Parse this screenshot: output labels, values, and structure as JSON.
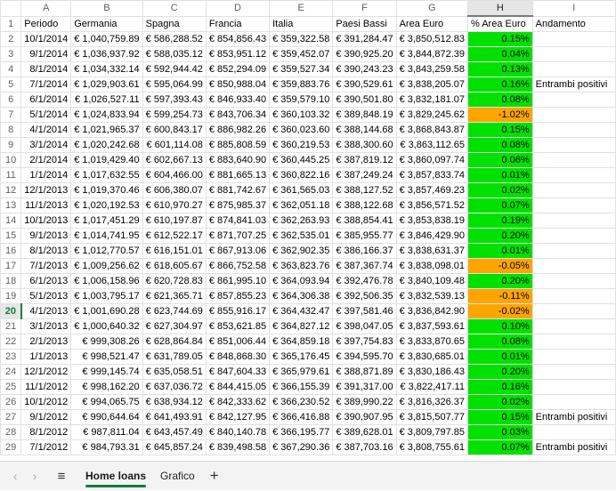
{
  "columns": [
    "A",
    "B",
    "C",
    "D",
    "E",
    "F",
    "G",
    "H",
    "I"
  ],
  "active_column": "H",
  "selected_row": "20",
  "header_row": {
    "row": "1",
    "cells": [
      "Periodo",
      "Germania",
      "Spagna",
      "Francia",
      "Italia",
      "Paesi Bassi",
      "Area Euro",
      "% Area Euro",
      "Andamento"
    ]
  },
  "rows": [
    {
      "row": "2",
      "c": [
        "10/1/2014",
        "€ 1,040,759.89",
        "€ 586,288.52",
        "€ 854,856.43",
        "€ 359,322.58",
        "€ 391,284.47",
        "€ 3,850,512.83",
        "0.15%",
        ""
      ],
      "status": "green"
    },
    {
      "row": "3",
      "c": [
        "9/1/2014",
        "€ 1,036,937.92",
        "€ 588,035.12",
        "€ 853,951.12",
        "€ 359,452.07",
        "€ 390,925.20",
        "€ 3,844,872.39",
        "0.04%",
        ""
      ],
      "status": "green"
    },
    {
      "row": "4",
      "c": [
        "8/1/2014",
        "€ 1,034,332.14",
        "€ 592,944.42",
        "€ 852,294.09",
        "€ 359,527.34",
        "€ 390,243.23",
        "€ 3,843,259.58",
        "0.13%",
        ""
      ],
      "status": "green"
    },
    {
      "row": "5",
      "c": [
        "7/1/2014",
        "€ 1,029,903.61",
        "€ 595,064.99",
        "€ 850,988.04",
        "€ 359,883.76",
        "€ 390,529.61",
        "€ 3,838,205.07",
        "0.16%",
        "Entrambi positivi"
      ],
      "status": "green"
    },
    {
      "row": "6",
      "c": [
        "6/1/2014",
        "€ 1,026,527.11",
        "€ 597,393.43",
        "€ 846,933.40",
        "€ 359,579.10",
        "€ 390,501.80",
        "€ 3,832,181.07",
        "0.08%",
        ""
      ],
      "status": "green"
    },
    {
      "row": "7",
      "c": [
        "5/1/2014",
        "€ 1,024,833.94",
        "€ 599,254.73",
        "€ 843,706.34",
        "€ 360,103.32",
        "€ 389,848.19",
        "€ 3,829,245.62",
        "-1.02%",
        ""
      ],
      "status": "orange"
    },
    {
      "row": "8",
      "c": [
        "4/1/2014",
        "€ 1,021,965.37",
        "€ 600,843.17",
        "€ 886,982.26",
        "€ 360,023.60",
        "€ 388,144.68",
        "€ 3,868,843.87",
        "0.15%",
        ""
      ],
      "status": "green"
    },
    {
      "row": "9",
      "c": [
        "3/1/2014",
        "€ 1,020,242.68",
        "€ 601,114.08",
        "€ 885,808.59",
        "€ 360,219.53",
        "€ 388,300.60",
        "€ 3,863,112.65",
        "0.08%",
        ""
      ],
      "status": "green"
    },
    {
      "row": "10",
      "c": [
        "2/1/2014",
        "€ 1,019,429.40",
        "€ 602,667.13",
        "€ 883,640.90",
        "€ 360,445.25",
        "€ 387,819.12",
        "€ 3,860,097.74",
        "0.06%",
        ""
      ],
      "status": "green"
    },
    {
      "row": "11",
      "c": [
        "1/1/2014",
        "€ 1,017,632.55",
        "€ 604,466.00",
        "€ 881,665.13",
        "€ 360,822.16",
        "€ 387,249.24",
        "€ 3,857,833.74",
        "0.01%",
        ""
      ],
      "status": "green"
    },
    {
      "row": "12",
      "c": [
        "12/1/2013",
        "€ 1,019,370.46",
        "€ 606,380.07",
        "€ 881,742.67",
        "€ 361,565.03",
        "€ 388,127.52",
        "€ 3,857,469.23",
        "0.02%",
        ""
      ],
      "status": "green"
    },
    {
      "row": "13",
      "c": [
        "11/1/2013",
        "€ 1,020,192.53",
        "€ 610,970.27",
        "€ 875,985.37",
        "€ 362,051.18",
        "€ 388,122.68",
        "€ 3,856,571.52",
        "0.07%",
        ""
      ],
      "status": "green"
    },
    {
      "row": "14",
      "c": [
        "10/1/2013",
        "€ 1,017,451.29",
        "€ 610,197.87",
        "€ 874,841.03",
        "€ 362,263.93",
        "€ 388,854.41",
        "€ 3,853,838.19",
        "0.19%",
        ""
      ],
      "status": "green"
    },
    {
      "row": "15",
      "c": [
        "9/1/2013",
        "€ 1,014,741.95",
        "€ 612,522.17",
        "€ 871,707.25",
        "€ 362,535.01",
        "€ 385,955.77",
        "€ 3,846,429.90",
        "0.20%",
        ""
      ],
      "status": "green"
    },
    {
      "row": "16",
      "c": [
        "8/1/2013",
        "€ 1,012,770.57",
        "€ 616,151.01",
        "€ 867,913.06",
        "€ 362,902.35",
        "€ 386,166.37",
        "€ 3,838,631.37",
        "0.01%",
        ""
      ],
      "status": "green"
    },
    {
      "row": "17",
      "c": [
        "7/1/2013",
        "€ 1,009,256.62",
        "€ 618,605.67",
        "€ 866,752.58",
        "€ 363,823.76",
        "€ 387,367.74",
        "€ 3,838,098.01",
        "-0.05%",
        ""
      ],
      "status": "orange"
    },
    {
      "row": "18",
      "c": [
        "6/1/2013",
        "€ 1,006,158.96",
        "€ 620,728.83",
        "€ 861,995.10",
        "€ 364,093.94",
        "€ 392,476.78",
        "€ 3,840,109.48",
        "0.20%",
        ""
      ],
      "status": "green"
    },
    {
      "row": "19",
      "c": [
        "5/1/2013",
        "€ 1,003,795.17",
        "€ 621,365.71",
        "€ 857,855.23",
        "€ 364,306.38",
        "€ 392,506.35",
        "€ 3,832,539.13",
        "-0.11%",
        ""
      ],
      "status": "orange"
    },
    {
      "row": "20",
      "c": [
        "4/1/2013",
        "€ 1,001,690.28",
        "€ 623,744.69",
        "€ 855,916.17",
        "€ 364,432.47",
        "€ 397,581.46",
        "€ 3,836,842.90",
        "-0.02%",
        ""
      ],
      "status": "orange"
    },
    {
      "row": "21",
      "c": [
        "3/1/2013",
        "€ 1,000,640.32",
        "€ 627,304.97",
        "€ 853,621.85",
        "€ 364,827.12",
        "€ 398,047.05",
        "€ 3,837,593.61",
        "0.10%",
        ""
      ],
      "status": "green"
    },
    {
      "row": "22",
      "c": [
        "2/1/2013",
        "€ 999,308.26",
        "€ 628,864.84",
        "€ 851,006.44",
        "€ 364,859.18",
        "€ 397,754.83",
        "€ 3,833,870.65",
        "0.08%",
        ""
      ],
      "status": "green"
    },
    {
      "row": "23",
      "c": [
        "1/1/2013",
        "€ 998,521.47",
        "€ 631,789.05",
        "€ 848,868.30",
        "€ 365,176.45",
        "€ 394,595.70",
        "€ 3,830,685.01",
        "0.01%",
        ""
      ],
      "status": "green"
    },
    {
      "row": "24",
      "c": [
        "12/1/2012",
        "€ 999,145.74",
        "€ 635,058.51",
        "€ 847,604.33",
        "€ 365,979.61",
        "€ 388,871.89",
        "€ 3,830,186.43",
        "0.20%",
        ""
      ],
      "status": "green"
    },
    {
      "row": "25",
      "c": [
        "11/1/2012",
        "€ 998,162.20",
        "€ 637,036.72",
        "€ 844,415.05",
        "€ 366,155.39",
        "€ 391,317.00",
        "€ 3,822,417.11",
        "0.16%",
        ""
      ],
      "status": "green"
    },
    {
      "row": "26",
      "c": [
        "10/1/2012",
        "€ 994,065.75",
        "€ 638,934.12",
        "€ 842,333.62",
        "€ 366,230.52",
        "€ 389,990.22",
        "€ 3,816,326.37",
        "0.02%",
        ""
      ],
      "status": "green"
    },
    {
      "row": "27",
      "c": [
        "9/1/2012",
        "€ 990,644.64",
        "€ 641,493.91",
        "€ 842,127.95",
        "€ 366,416.88",
        "€ 390,907.95",
        "€ 3,815,507.77",
        "0.15%",
        "Entrambi positivi"
      ],
      "status": "green"
    },
    {
      "row": "28",
      "c": [
        "8/1/2012",
        "€ 987,811.04",
        "€ 643,457.49",
        "€ 840,140.78",
        "€ 366,195.77",
        "€ 389,628.01",
        "€ 3,809,797.85",
        "0.03%",
        ""
      ],
      "status": "green"
    },
    {
      "row": "29",
      "c": [
        "7/1/2012",
        "€ 984,793.31",
        "€ 645,857.24",
        "€ 839,498.58",
        "€ 367,290.36",
        "€ 387,703.16",
        "€ 3,808,755.61",
        "0.07%",
        "Entrambi positivi"
      ],
      "status": "green"
    }
  ],
  "sheet_tabs": [
    "Home loans",
    "Grafico"
  ],
  "active_tab": "Home loans",
  "colors": {
    "positive": "#00e100",
    "negative": "#ffa500",
    "accent": "#107c41"
  },
  "icons": {
    "prev": "chevron-left-icon",
    "next": "chevron-right-icon",
    "menu": "hamburger-menu-icon",
    "add": "plus-icon"
  }
}
